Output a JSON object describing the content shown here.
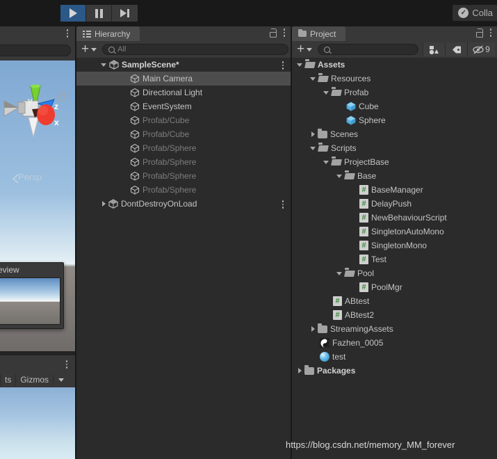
{
  "toolbar": {
    "play_label": "Play",
    "pause_label": "Pause",
    "step_label": "Step",
    "collab_label": "Colla"
  },
  "scene_view": {
    "perspective_label": "Persp",
    "axis_y": "y",
    "axis_x": "x",
    "axis_z": "z",
    "colors": {
      "x_axis": "#f03c2e",
      "y_axis": "#76d130",
      "z_axis": "#2a7fe8"
    }
  },
  "preview_window": {
    "title": "review"
  },
  "scene_bottom_bar": {
    "effects_label": "ts",
    "gizmos_label": "Gizmos"
  },
  "hierarchy": {
    "tab_label": "Hierarchy",
    "create_label": "+",
    "search_placeholder": "All",
    "items": [
      {
        "label": "SampleScene*",
        "icon": "scene-icon",
        "depth": 0,
        "arrow": "down",
        "selected": false,
        "dim": false,
        "bold": true,
        "kebab": true
      },
      {
        "label": "Main Camera",
        "icon": "gameobject-icon",
        "depth": 1,
        "arrow": "none",
        "selected": true,
        "dim": false,
        "bold": false,
        "kebab": false
      },
      {
        "label": "Directional Light",
        "icon": "gameobject-icon",
        "depth": 1,
        "arrow": "none",
        "selected": false,
        "dim": false,
        "bold": false,
        "kebab": false
      },
      {
        "label": "EventSystem",
        "icon": "gameobject-icon",
        "depth": 1,
        "arrow": "none",
        "selected": false,
        "dim": false,
        "bold": false,
        "kebab": false
      },
      {
        "label": "Profab/Cube",
        "icon": "gameobject-icon",
        "depth": 1,
        "arrow": "none",
        "selected": false,
        "dim": true,
        "bold": false,
        "kebab": false
      },
      {
        "label": "Profab/Cube",
        "icon": "gameobject-icon",
        "depth": 1,
        "arrow": "none",
        "selected": false,
        "dim": true,
        "bold": false,
        "kebab": false
      },
      {
        "label": "Profab/Sphere",
        "icon": "gameobject-icon",
        "depth": 1,
        "arrow": "none",
        "selected": false,
        "dim": true,
        "bold": false,
        "kebab": false
      },
      {
        "label": "Profab/Sphere",
        "icon": "gameobject-icon",
        "depth": 1,
        "arrow": "none",
        "selected": false,
        "dim": true,
        "bold": false,
        "kebab": false
      },
      {
        "label": "Profab/Sphere",
        "icon": "gameobject-icon",
        "depth": 1,
        "arrow": "none",
        "selected": false,
        "dim": true,
        "bold": false,
        "kebab": false
      },
      {
        "label": "Profab/Sphere",
        "icon": "gameobject-icon",
        "depth": 1,
        "arrow": "none",
        "selected": false,
        "dim": true,
        "bold": false,
        "kebab": false
      },
      {
        "label": "DontDestroyOnLoad",
        "icon": "scene-icon",
        "depth": 0,
        "arrow": "right",
        "selected": false,
        "dim": false,
        "bold": false,
        "kebab": true
      }
    ]
  },
  "project": {
    "tab_label": "Project",
    "create_label": "+",
    "search_placeholder": "",
    "hidden_count": "9",
    "filter_type_icon": "filter-by-type-icon",
    "filter_label_icon": "filter-by-label-icon",
    "visibility_icon": "hidden-items-icon",
    "items": [
      {
        "label": "Assets",
        "icon": "folder-open-icon",
        "depth": 0,
        "arrow": "down",
        "bold": true
      },
      {
        "label": "Resources",
        "icon": "folder-open-icon",
        "depth": 1,
        "arrow": "down",
        "bold": false
      },
      {
        "label": "Profab",
        "icon": "folder-open-icon",
        "depth": 2,
        "arrow": "down",
        "bold": false
      },
      {
        "label": "Cube",
        "icon": "prefab-icon",
        "depth": 3,
        "arrow": "none",
        "bold": false
      },
      {
        "label": "Sphere",
        "icon": "prefab-icon",
        "depth": 3,
        "arrow": "none",
        "bold": false
      },
      {
        "label": "Scenes",
        "icon": "folder-icon",
        "depth": 1,
        "arrow": "right",
        "bold": false
      },
      {
        "label": "Scripts",
        "icon": "folder-open-icon",
        "depth": 1,
        "arrow": "down",
        "bold": false
      },
      {
        "label": "ProjectBase",
        "icon": "folder-open-icon",
        "depth": 2,
        "arrow": "down",
        "bold": false
      },
      {
        "label": "Base",
        "icon": "folder-open-icon",
        "depth": 3,
        "arrow": "down",
        "bold": false
      },
      {
        "label": "BaseManager",
        "icon": "script-icon",
        "depth": 4,
        "arrow": "none",
        "bold": false
      },
      {
        "label": "DelayPush",
        "icon": "script-icon",
        "depth": 4,
        "arrow": "none",
        "bold": false
      },
      {
        "label": "NewBehaviourScript",
        "icon": "script-icon",
        "depth": 4,
        "arrow": "none",
        "bold": false
      },
      {
        "label": "SingletonAutoMono",
        "icon": "script-icon",
        "depth": 4,
        "arrow": "none",
        "bold": false
      },
      {
        "label": "SingletonMono",
        "icon": "script-icon",
        "depth": 4,
        "arrow": "none",
        "bold": false
      },
      {
        "label": "Test",
        "icon": "script-icon",
        "depth": 4,
        "arrow": "none",
        "bold": false
      },
      {
        "label": "Pool",
        "icon": "folder-open-icon",
        "depth": 3,
        "arrow": "down",
        "bold": false
      },
      {
        "label": "PoolMgr",
        "icon": "script-icon",
        "depth": 4,
        "arrow": "none",
        "bold": false
      },
      {
        "label": "ABtest",
        "icon": "script-icon",
        "depth": 2,
        "arrow": "none",
        "bold": false
      },
      {
        "label": "ABtest2",
        "icon": "script-icon",
        "depth": 2,
        "arrow": "none",
        "bold": false
      },
      {
        "label": "StreamingAssets",
        "icon": "folder-icon",
        "depth": 1,
        "arrow": "right",
        "bold": false
      },
      {
        "label": "Fazhen_0005",
        "icon": "image-asset-icon",
        "depth": 1,
        "arrow": "none",
        "bold": false
      },
      {
        "label": "test",
        "icon": "material-icon",
        "depth": 1,
        "arrow": "none",
        "bold": false
      },
      {
        "label": "Packages",
        "icon": "folder-icon",
        "depth": 0,
        "arrow": "right",
        "bold": true
      }
    ]
  },
  "watermark": {
    "text": "https://blog.csdn.net/memory_MM_forever"
  }
}
